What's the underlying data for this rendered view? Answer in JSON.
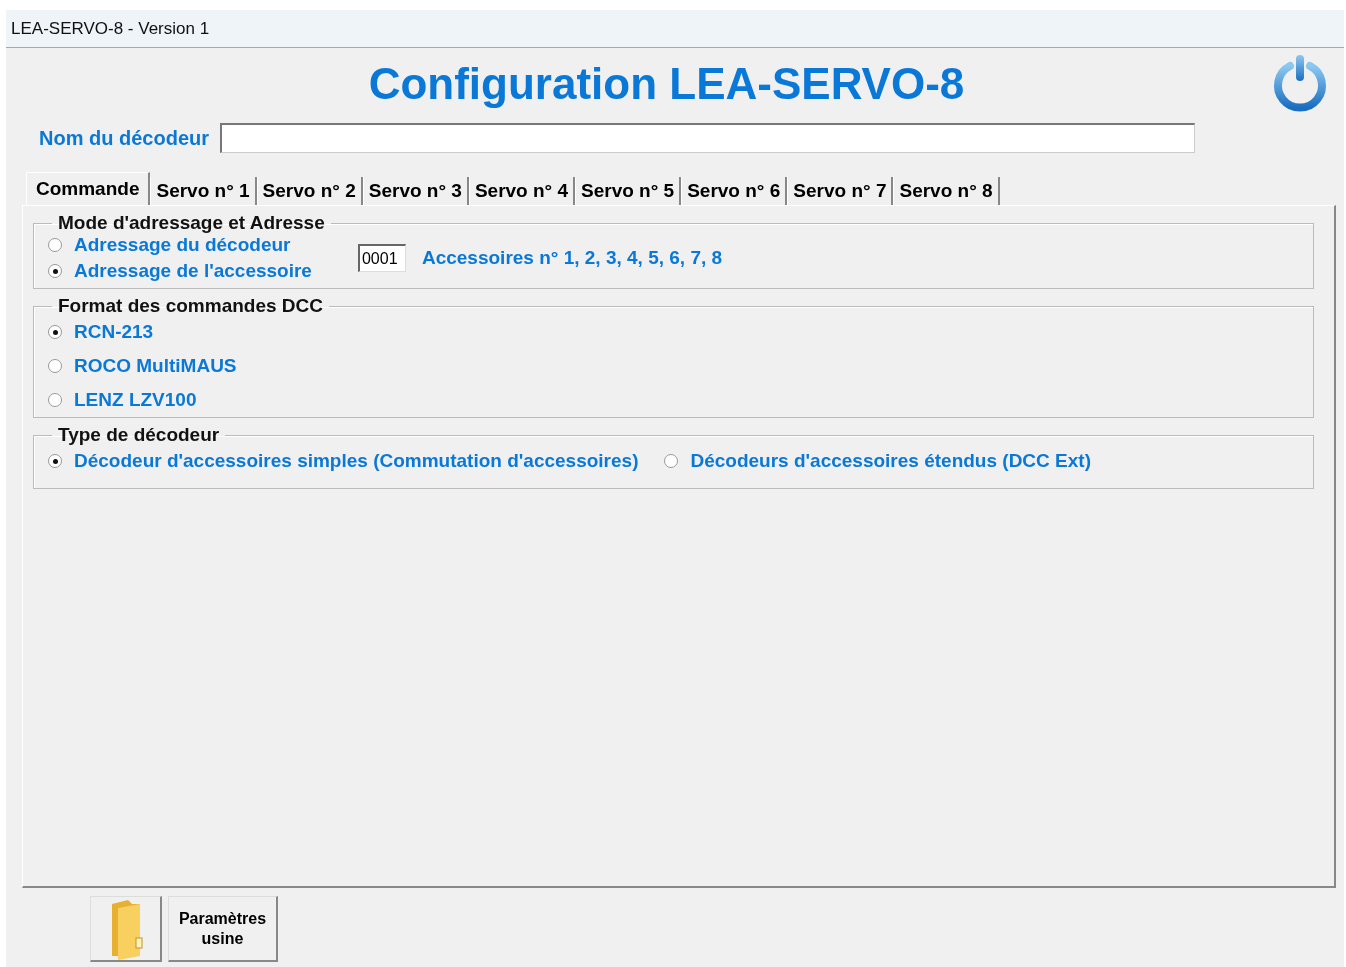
{
  "window": {
    "title": "LEA-SERVO-8 - Version 1"
  },
  "header": {
    "title": "Configuration LEA-SERVO-8"
  },
  "decoder_name": {
    "label": "Nom du décodeur"
  },
  "tabs": [
    {
      "label": "Commande",
      "selected": true
    },
    {
      "label": "Servo n° 1",
      "selected": false
    },
    {
      "label": "Servo n° 2",
      "selected": false
    },
    {
      "label": "Servo n° 3",
      "selected": false
    },
    {
      "label": "Servo n° 4",
      "selected": false
    },
    {
      "label": "Servo n° 5",
      "selected": false
    },
    {
      "label": "Servo n° 6",
      "selected": false
    },
    {
      "label": "Servo n° 7",
      "selected": false
    },
    {
      "label": "Servo n° 8",
      "selected": false
    }
  ],
  "groups": [
    {
      "kind": "addressing",
      "title": "Mode d'adressage et Adresse",
      "options": [
        {
          "label": "Adressage du décodeur",
          "selected": false
        },
        {
          "label": "Adressage de l'accessoire",
          "selected": true
        }
      ],
      "address": {
        "value": "0001"
      },
      "accessories": "Accessoires n° 1, 2, 3, 4, 5, 6, 7, 8"
    },
    {
      "kind": "stacked",
      "title": "Format des commandes DCC",
      "options": [
        {
          "label": "RCN-213",
          "selected": true
        },
        {
          "label": "ROCO MultiMAUS",
          "selected": false
        },
        {
          "label": "LENZ LZV100",
          "selected": false
        }
      ]
    },
    {
      "kind": "inline",
      "title": "Type de décodeur",
      "options": [
        {
          "label": "Décodeur d'accessoires simples (Commutation d'accessoires)",
          "selected": true
        },
        {
          "label": "Décodeurs d'accessoires étendus (DCC Ext)",
          "selected": false
        }
      ]
    }
  ],
  "footer_buttons": [
    {
      "kind": "folder"
    },
    {
      "kind": "text",
      "label": "Paramètres\nusine"
    }
  ]
}
